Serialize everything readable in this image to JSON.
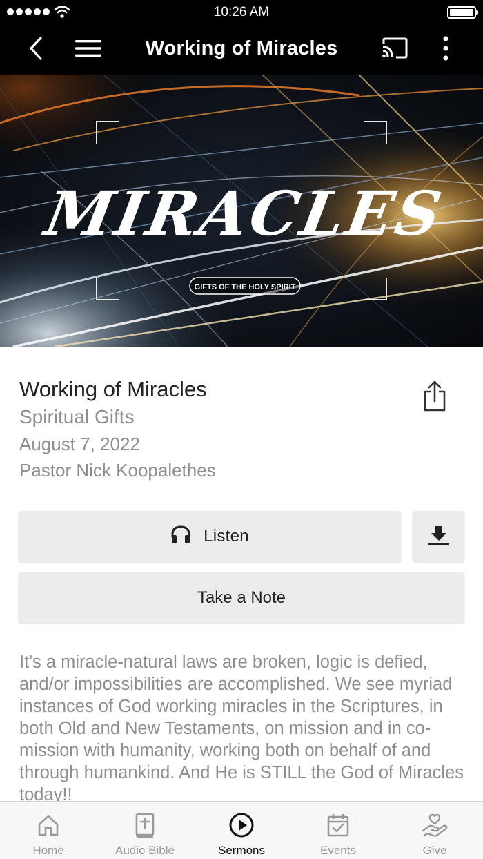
{
  "status_bar": {
    "time": "10:26 AM"
  },
  "nav": {
    "title": "Working of Miracles"
  },
  "hero": {
    "artwork_title": "MIRACLES",
    "artwork_subtitle": "GIFTS OF THE HOLY SPIRIT"
  },
  "sermon": {
    "title": "Working of Miracles",
    "series": "Spiritual Gifts",
    "date": "August 7, 2022",
    "speaker": "Pastor Nick Koopalethes",
    "description": "It's a miracle-natural laws are broken, logic is defied, and/or impossibilities are accomplished. We see myriad instances of God working miracles in the Scriptures, in both Old and New Testaments, on mission and in co-mission with humanity, working both on behalf of and through humankind. And He is STILL the God of Miracles today!!"
  },
  "actions": {
    "listen_label": "Listen",
    "note_label": "Take a Note"
  },
  "tabs": [
    {
      "label": "Home",
      "icon": "home-icon",
      "active": false
    },
    {
      "label": "Audio Bible",
      "icon": "bible-icon",
      "active": false
    },
    {
      "label": "Sermons",
      "icon": "play-circle-icon",
      "active": true
    },
    {
      "label": "Events",
      "icon": "calendar-check-icon",
      "active": false
    },
    {
      "label": "Give",
      "icon": "heart-hand-icon",
      "active": false
    }
  ],
  "colors": {
    "bar_background": "#000000",
    "active_tab": "#111111",
    "inactive_tab": "#9a9a9a",
    "muted_text": "#8e8e8e",
    "button_background": "#ececec"
  }
}
